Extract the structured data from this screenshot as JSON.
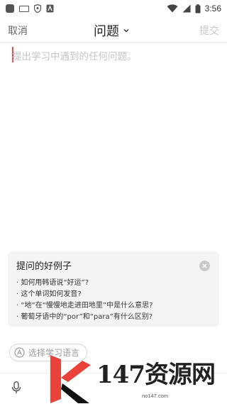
{
  "status_bar": {
    "time": "3:56",
    "icons": [
      "app-icon",
      "keyboard-icon",
      "shield-icon",
      "a-icon",
      "wifi-icon",
      "signal-icon",
      "battery-icon"
    ]
  },
  "nav": {
    "cancel_label": "取消",
    "title": "问题",
    "submit_label": "提交"
  },
  "question": {
    "placeholder": "提出学习中遇到的任何问题。",
    "value": ""
  },
  "examples": {
    "title": "提问的好例子",
    "items": [
      "· 如何用韩语说“好运”?",
      "· 这个单词如何发音?",
      "· “地”在“慢慢地走进田地里”中是什么意思?",
      "· 葡萄牙语中的“por”和“para”有什么区别?"
    ]
  },
  "language_chip": {
    "label": "选择学习语言"
  },
  "watermark": {
    "text": "147资源网",
    "url": "no147.com"
  },
  "colors": {
    "caret": "#e8514d",
    "muted": "#c8c8c8",
    "card_bg": "#f4f4f4"
  }
}
